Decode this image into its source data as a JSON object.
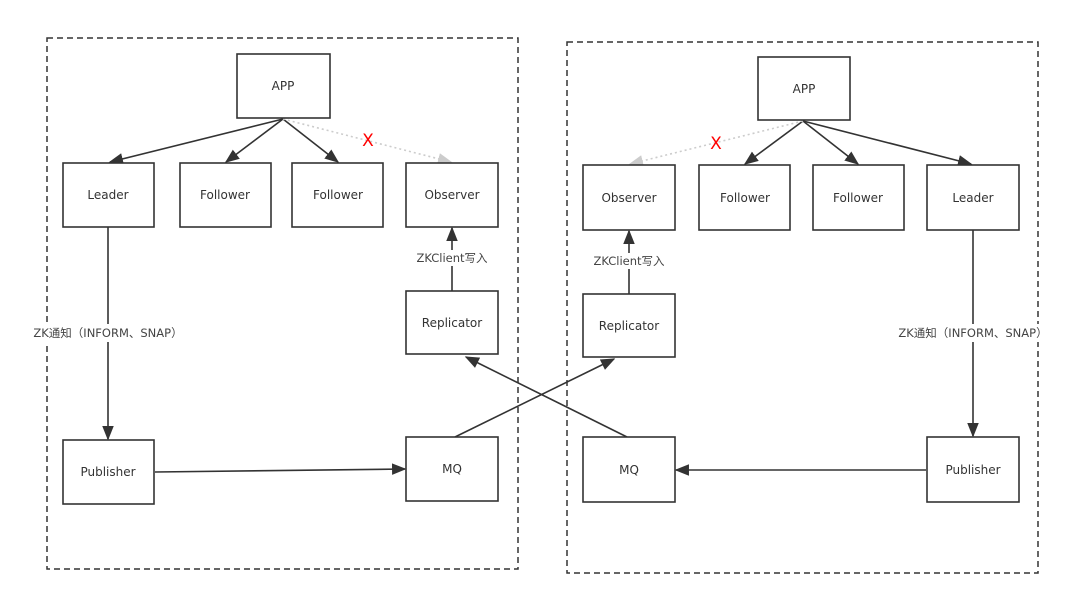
{
  "colors": {
    "line": "#333333",
    "blocked_line": "#cccccc",
    "blocked_mark": "#ff0000"
  },
  "left": {
    "app": "APP",
    "leader": "Leader",
    "follower1": "Follower",
    "follower2": "Follower",
    "observer": "Observer",
    "replicator": "Replicator",
    "publisher": "Publisher",
    "mq": "MQ",
    "zk_notify": "ZK通知（INFORM、SNAP）",
    "zkclient_write": "ZKClient写入",
    "blocked_mark": "X"
  },
  "right": {
    "app": "APP",
    "leader": "Leader",
    "follower1": "Follower",
    "follower2": "Follower",
    "observer": "Observer",
    "replicator": "Replicator",
    "publisher": "Publisher",
    "mq": "MQ",
    "zk_notify": "ZK通知（INFORM、SNAP）",
    "zkclient_write": "ZKClient写入",
    "blocked_mark": "X"
  }
}
